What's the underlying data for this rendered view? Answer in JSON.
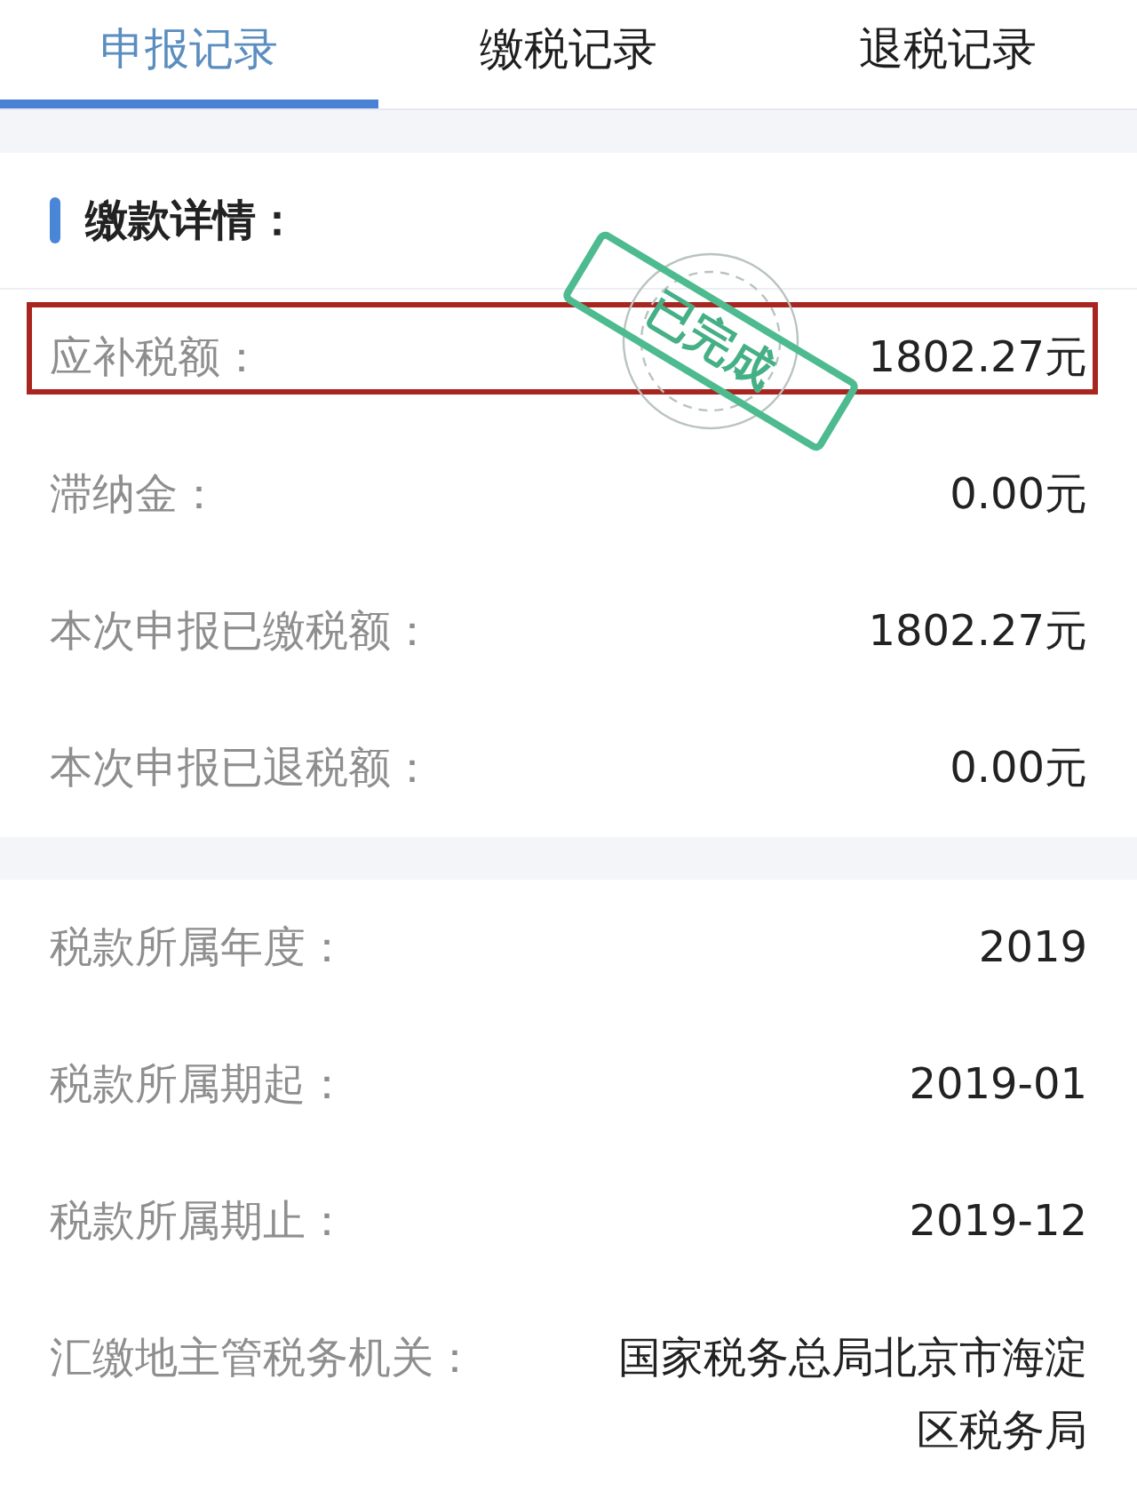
{
  "tabs": [
    {
      "label": "申报记录",
      "selected": true
    },
    {
      "label": "缴税记录",
      "selected": false
    },
    {
      "label": "退税记录",
      "selected": false
    }
  ],
  "sections": [
    {
      "title": "缴款详情：",
      "rows": [
        {
          "label": "应补税额：",
          "value": "1802.27元",
          "highlighted": true,
          "stamp": "已完成"
        },
        {
          "label": "滞纳金：",
          "value": "0.00元",
          "highlighted": false
        },
        {
          "label": "本次申报已缴税额：",
          "value": "1802.27元",
          "highlighted": false
        },
        {
          "label": "本次申报已退税额：",
          "value": "0.00元",
          "highlighted": false
        }
      ]
    },
    {
      "rows": [
        {
          "label": "税款所属年度：",
          "value": "2019",
          "highlighted": false
        },
        {
          "label": "税款所属期起：",
          "value": "2019-01",
          "highlighted": false
        },
        {
          "label": "税款所属期止：",
          "value": "2019-12",
          "highlighted": false
        },
        {
          "label": "汇缴地主管税务机关：",
          "value": "国家税务总局北京市海淀区税务局",
          "highlighted": false
        }
      ]
    }
  ]
}
